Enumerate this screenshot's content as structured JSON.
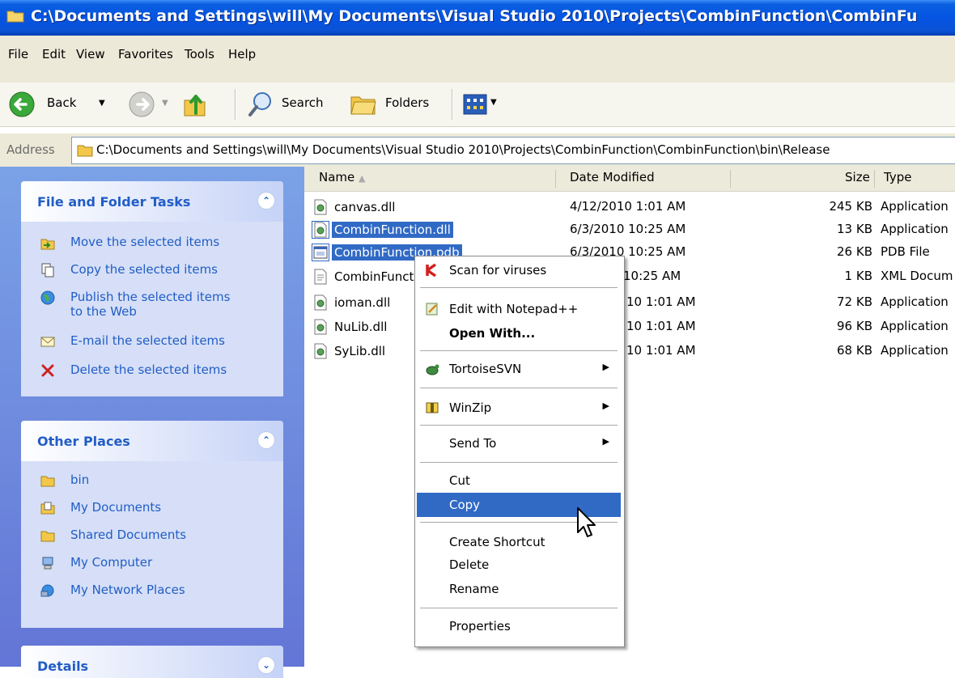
{
  "window": {
    "title": "C:\\Documents and Settings\\will\\My Documents\\Visual Studio 2010\\Projects\\CombinFunction\\CombinFu"
  },
  "menubar": [
    "File",
    "Edit",
    "View",
    "Favorites",
    "Tools",
    "Help"
  ],
  "toolbar": {
    "back_label": "Back",
    "search_label": "Search",
    "folders_label": "Folders"
  },
  "address": {
    "label": "Address",
    "value": "C:\\Documents and Settings\\will\\My Documents\\Visual Studio 2010\\Projects\\CombinFunction\\CombinFunction\\bin\\Release"
  },
  "left_pane": {
    "file_tasks": {
      "title": "File and Folder Tasks",
      "items": [
        "Move the selected items",
        "Copy the selected items",
        "Publish the selected items",
        "to the Web",
        "E-mail the selected items",
        "Delete the selected items"
      ]
    },
    "other_places": {
      "title": "Other Places",
      "items": [
        "bin",
        "My Documents",
        "Shared Documents",
        "My Computer",
        "My Network Places"
      ]
    },
    "details": {
      "title": "Details"
    }
  },
  "file_list": {
    "columns": [
      "Name",
      "Date Modified",
      "Size",
      "Type"
    ],
    "rows": [
      {
        "name": "canvas.dll",
        "date": "4/12/2010 1:01 AM",
        "size": "245 KB",
        "type": "Application",
        "selected": false
      },
      {
        "name": "CombinFunction.dll",
        "date": "6/3/2010 10:25 AM",
        "size": "13 KB",
        "type": "Application",
        "selected": true
      },
      {
        "name": "CombinFunction.pdb",
        "date": "6/3/2010 10:25 AM",
        "size": "26 KB",
        "type": "PDB File",
        "selected": true
      },
      {
        "name": "CombinFunct",
        "date": "10:25 AM",
        "size": "1 KB",
        "type": "XML Docum",
        "selected": false
      },
      {
        "name": "ioman.dll",
        "date": "10 1:01 AM",
        "size": "72 KB",
        "type": "Application",
        "selected": false
      },
      {
        "name": "NuLib.dll",
        "date": "10 1:01 AM",
        "size": "96 KB",
        "type": "Application",
        "selected": false
      },
      {
        "name": "SyLib.dll",
        "date": "10 1:01 AM",
        "size": "68 KB",
        "type": "Application",
        "selected": false
      }
    ]
  },
  "context_menu": {
    "scan": "Scan for viruses",
    "edit_notepad": "Edit with Notepad++",
    "open_with": "Open With...",
    "tortoise": "TortoiseSVN",
    "winzip": "WinZip",
    "send_to": "Send To",
    "cut": "Cut",
    "copy": "Copy",
    "create_shortcut": "Create Shortcut",
    "delete": "Delete",
    "rename": "Rename",
    "properties": "Properties",
    "highlighted": "Copy"
  },
  "colors": {
    "title_blue": "#0554e3",
    "selection": "#316ac5",
    "task_text": "#215dc6"
  }
}
